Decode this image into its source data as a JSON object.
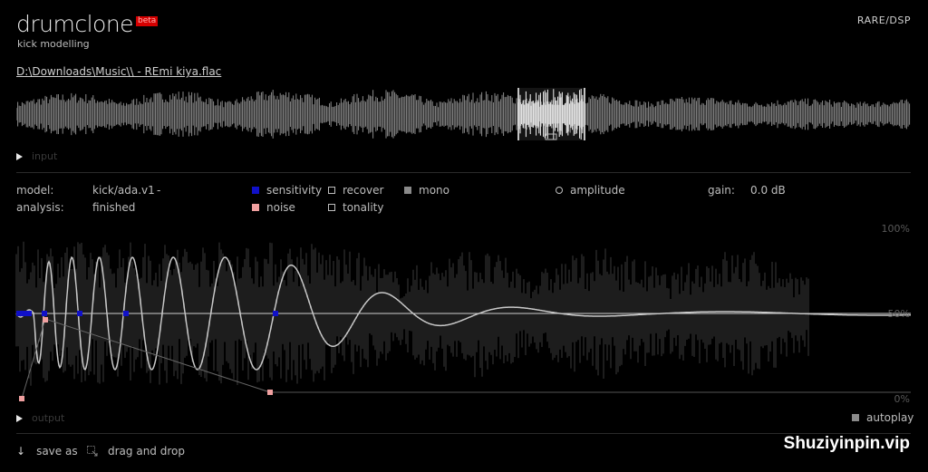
{
  "app": {
    "title": "drumclone",
    "badge": "beta",
    "subtitle": "kick modelling",
    "brand": "RARE/DSP"
  },
  "file": {
    "path": "D:\\Downloads\\Music\\\\ - REmi kiya.flac"
  },
  "input": {
    "label": "input"
  },
  "info": {
    "model_label": "model:",
    "model_value": "kick/ada.v1",
    "model_menu": "-",
    "analysis_label": "analysis:",
    "analysis_value": "finished",
    "gain_label": "gain:",
    "gain_value": "0.0 dB"
  },
  "options": {
    "sensitivity": "sensitivity",
    "noise": "noise",
    "recover": "recover",
    "tonality": "tonality",
    "mono": "mono",
    "amplitude": "amplitude"
  },
  "scale": {
    "top": "100%",
    "mid": "50%",
    "bottom": "0%"
  },
  "output": {
    "label": "output",
    "autoplay": "autoplay"
  },
  "footer": {
    "save_as": "save as",
    "drag_drop": "drag and drop"
  },
  "watermark": "Shuziyinpin.vip",
  "colors": {
    "sensitivity": "#1010c8",
    "noise": "#f0a0a0",
    "mono": "#8a8a8a",
    "beta": "#d40000"
  },
  "icons": {
    "play": "play-icon",
    "save": "arrow-down-icon",
    "drag": "drag-drop-icon"
  }
}
